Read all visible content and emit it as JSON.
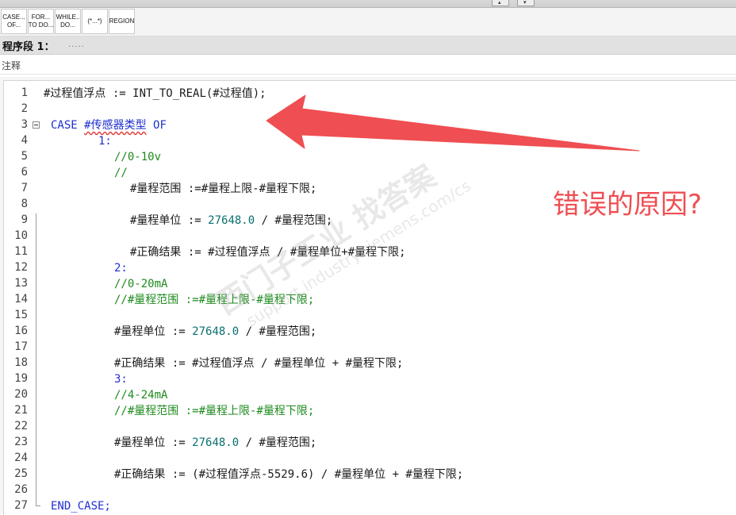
{
  "toolbar": {
    "buttons": [
      {
        "line1": "CASE...",
        "line2": "OF..."
      },
      {
        "line1": "FOR...",
        "line2": "TO DO..."
      },
      {
        "line1": "WHILE..",
        "line2": "DO..."
      },
      {
        "line1": "(*...*)",
        "line2": ""
      },
      {
        "line1": "REGION",
        "line2": ""
      }
    ]
  },
  "segment": {
    "title": "程序段 1：",
    "placeholder": "....."
  },
  "comment": {
    "label": "注释"
  },
  "editor": {
    "lines": [
      {
        "num": "1",
        "text": "#过程值浮点 := INT_TO_REAL(#过程值);"
      },
      {
        "num": "2",
        "text": ""
      },
      {
        "num": "3",
        "text": "CASE #传感器类型 OF"
      },
      {
        "num": "4",
        "text": "1:"
      },
      {
        "num": "5",
        "text": "//0-10v"
      },
      {
        "num": "6",
        "text": "//"
      },
      {
        "num": "7",
        "text": "#量程范围 :=#量程上限-#量程下限;"
      },
      {
        "num": "8",
        "text": ""
      },
      {
        "num": "9",
        "text": "#量程单位 := 27648.0 / #量程范围;"
      },
      {
        "num": "10",
        "text": ""
      },
      {
        "num": "11",
        "text": "#正确结果 := #过程值浮点 / #量程单位+#量程下限;"
      },
      {
        "num": "12",
        "text": "2:"
      },
      {
        "num": "13",
        "text": "//0-20mA"
      },
      {
        "num": "14",
        "text": "//#量程范围 :=#量程上限-#量程下限;"
      },
      {
        "num": "15",
        "text": ""
      },
      {
        "num": "16",
        "text": "#量程单位 := 27648.0 / #量程范围;"
      },
      {
        "num": "17",
        "text": ""
      },
      {
        "num": "18",
        "text": "#正确结果 := #过程值浮点 / #量程单位 + #量程下限;"
      },
      {
        "num": "19",
        "text": "3:"
      },
      {
        "num": "20",
        "text": "//4-24mA"
      },
      {
        "num": "21",
        "text": "//#量程范围 :=#量程上限-#量程下限;"
      },
      {
        "num": "22",
        "text": ""
      },
      {
        "num": "23",
        "text": "#量程单位 := 27648.0 / #量程范围;"
      },
      {
        "num": "24",
        "text": ""
      },
      {
        "num": "25",
        "text": "#正确结果 := (#过程值浮点-5529.6) / #量程单位 + #量程下限;"
      },
      {
        "num": "26",
        "text": ""
      },
      {
        "num": "27",
        "text": "END_CASE;"
      }
    ],
    "code": {
      "l1": {
        "var": "#过程值浮点",
        "op": " := ",
        "fn": "INT_TO_REAL(#过程值);"
      },
      "l3": {
        "kw1": "CASE",
        "var": "#传感器类型",
        "kw2": "OF"
      },
      "l4": "1:",
      "l5": "//0-10v",
      "l6": "//",
      "l7": "#量程范围 :=#量程上限-#量程下限;",
      "l9": {
        "a": "#量程单位 := ",
        "num": "27648.0",
        "b": " / #量程范围;"
      },
      "l11": "#正确结果 := #过程值浮点 / #量程单位+#量程下限;",
      "l12": "2:",
      "l13": "//0-20mA",
      "l14": "//#量程范围 :=#量程上限-#量程下限;",
      "l16": {
        "a": "#量程单位 := ",
        "num": "27648.0",
        "b": " / #量程范围;"
      },
      "l18": "#正确结果 := #过程值浮点 / #量程单位 + #量程下限;",
      "l19": "3:",
      "l20": "//4-24mA",
      "l21": "//#量程范围 :=#量程上限-#量程下限;",
      "l23": {
        "a": "#量程单位 := ",
        "num": "27648.0",
        "b": " / #量程范围;"
      },
      "l25": "#正确结果 := (#过程值浮点-5529.6) / #量程单位 + #量程下限;",
      "l27": "END_CASE;"
    }
  },
  "annotation": {
    "text": "错误的原因?",
    "color": "#ef4e52"
  },
  "watermark": {
    "line1": "西门子工业 找答案",
    "line2": "support.industry.siemens.com/cs"
  },
  "colors": {
    "keyword": "#1f2fcf",
    "comment": "#1e8a1e",
    "number": "#0a6f6f",
    "text": "#1a1a1a"
  }
}
